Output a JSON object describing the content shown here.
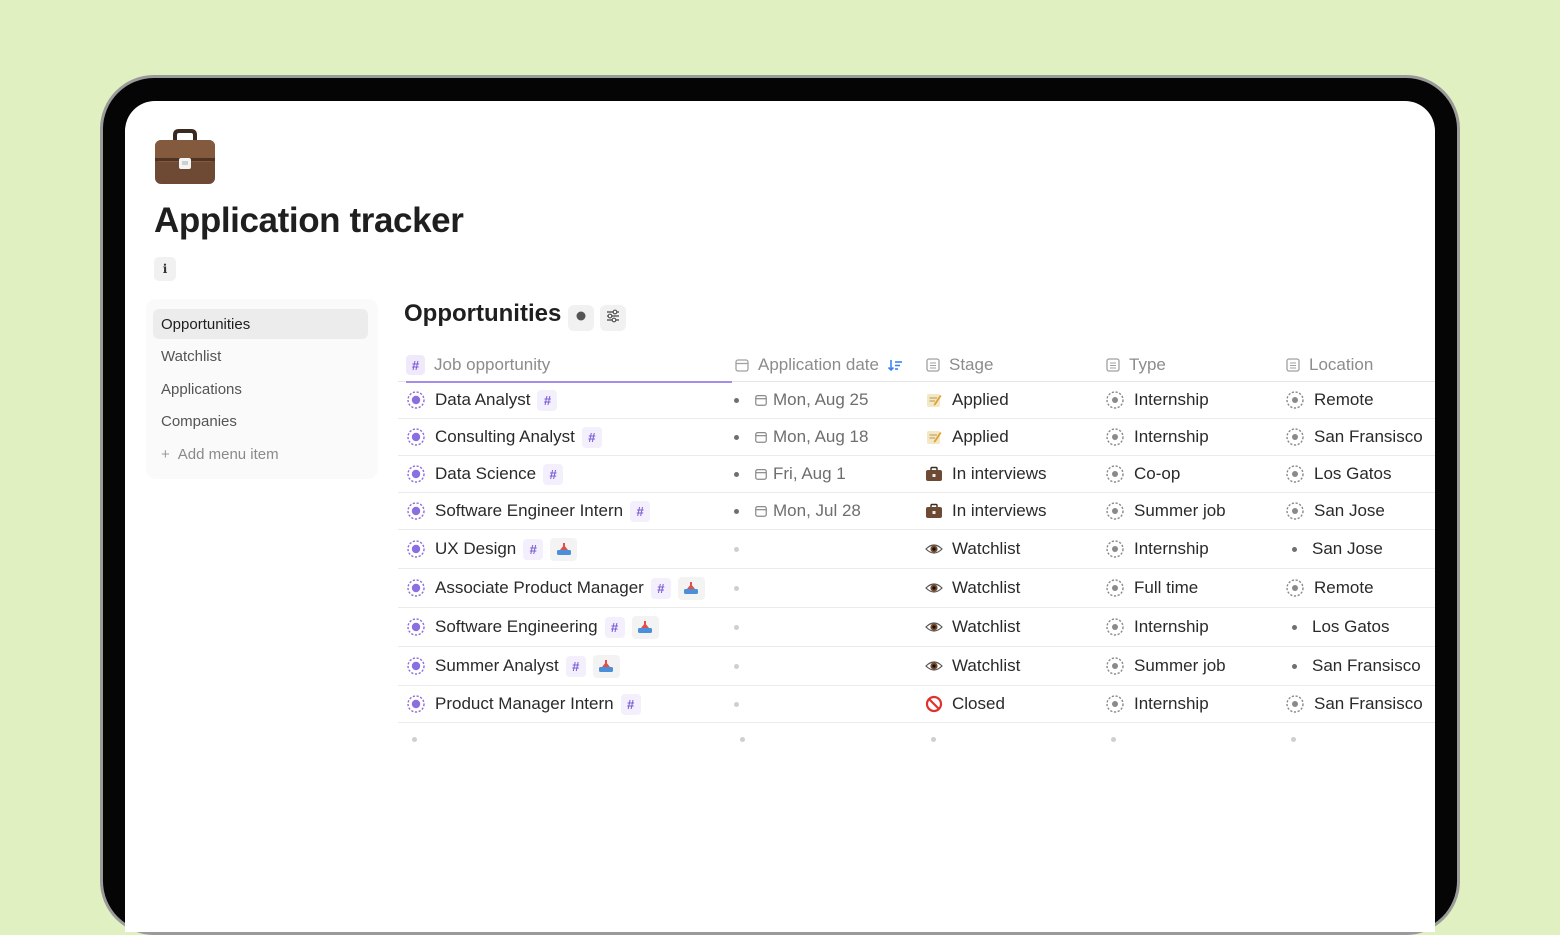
{
  "page": {
    "title": "Application tracker",
    "icon": "briefcase-icon",
    "info_label": "i"
  },
  "sidebar": {
    "items": [
      {
        "label": "Opportunities",
        "active": true
      },
      {
        "label": "Watchlist",
        "active": false
      },
      {
        "label": "Applications",
        "active": false
      },
      {
        "label": "Companies",
        "active": false
      }
    ],
    "add_label": "Add menu item"
  },
  "view": {
    "title": "Opportunities",
    "buttons": [
      "record-icon",
      "filter-icon"
    ]
  },
  "table": {
    "columns": [
      "Job opportunity",
      "Application date",
      "Stage",
      "Type",
      "Location"
    ],
    "rows": [
      {
        "title": "Data Analyst",
        "stack": false,
        "date": "Mon, Aug 25",
        "stage": "Applied",
        "type": "Internship",
        "location": "Remote"
      },
      {
        "title": "Consulting Analyst",
        "stack": false,
        "date": "Mon, Aug 18",
        "stage": "Applied",
        "type": "Internship",
        "location": "San Fransisco"
      },
      {
        "title": "Data Science",
        "stack": false,
        "date": "Fri, Aug 1",
        "stage": "In interviews",
        "type": "Co-op",
        "location": "Los Gatos"
      },
      {
        "title": "Software Engineer Intern",
        "stack": false,
        "date": "Mon, Jul 28",
        "stage": "In interviews",
        "type": "Summer job",
        "location": "San Jose"
      },
      {
        "title": "UX Design",
        "stack": true,
        "date": "",
        "stage": "Watchlist",
        "type": "Internship",
        "location": "San Jose"
      },
      {
        "title": "Associate Product Manager",
        "stack": true,
        "date": "",
        "stage": "Watchlist",
        "type": "Full time",
        "location": "Remote"
      },
      {
        "title": "Software Engineering",
        "stack": true,
        "date": "",
        "stage": "Watchlist",
        "type": "Internship",
        "location": "Los Gatos"
      },
      {
        "title": "Summer Analyst",
        "stack": true,
        "date": "",
        "stage": "Watchlist",
        "type": "Summer job",
        "location": "San Fransisco"
      },
      {
        "title": "Product Manager Intern",
        "stack": false,
        "date": "",
        "stage": "Closed",
        "type": "Internship",
        "location": "San Fransisco"
      }
    ]
  },
  "colors": {
    "background": "#e1f0c1",
    "accent_purple": "#7b5cd6",
    "header_underline": "#a58ee9"
  }
}
